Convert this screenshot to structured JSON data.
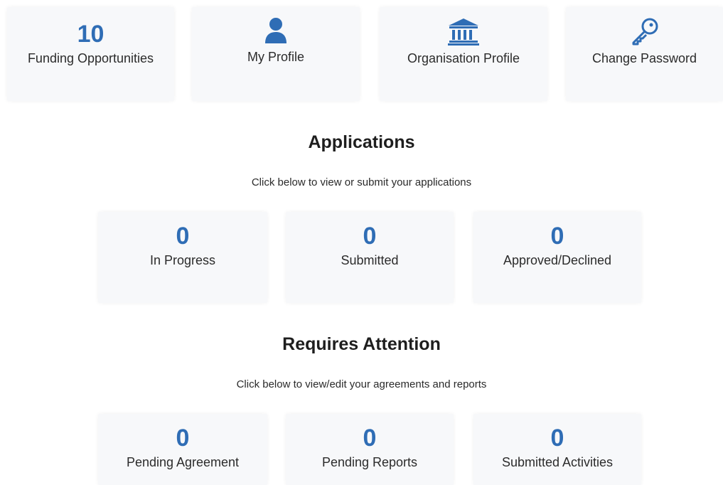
{
  "colors": {
    "accent": "#2f6db5",
    "tile_bg": "#f7f8fa"
  },
  "top_tiles": {
    "funding": {
      "count": "10",
      "label": "Funding Opportunities"
    },
    "profile": {
      "icon": "user-icon",
      "label": "My Profile"
    },
    "organisation": {
      "icon": "bank-icon",
      "label": "Organisation Profile"
    },
    "password": {
      "icon": "key-icon",
      "label": "Change Password"
    }
  },
  "applications": {
    "title": "Applications",
    "subtitle": "Click below to view or submit your applications",
    "items": [
      {
        "count": "0",
        "label": "In Progress"
      },
      {
        "count": "0",
        "label": "Submitted"
      },
      {
        "count": "0",
        "label": "Approved/Declined"
      }
    ]
  },
  "attention": {
    "title": "Requires Attention",
    "subtitle": "Click below to view/edit your agreements and reports",
    "items": [
      {
        "count": "0",
        "label": "Pending Agreement"
      },
      {
        "count": "0",
        "label": "Pending Reports"
      },
      {
        "count": "0",
        "label": "Submitted Activities"
      }
    ]
  }
}
